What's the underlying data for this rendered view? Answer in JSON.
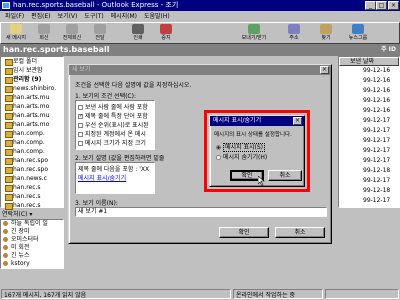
{
  "window": {
    "title": "han.rec.sports.baseball - Outlook Express - 조기"
  },
  "menu": [
    "파일(F)",
    "편집(E)",
    "보기(V)",
    "도구(T)",
    "메시지(M)",
    "도움말(H)"
  ],
  "toolbar": [
    "새 메시지",
    "회신",
    "전체회신",
    "전달",
    "인쇄",
    "중지",
    "보내기/받기",
    "주소",
    "찾기",
    "뉴스그룹"
  ],
  "folder_bar": {
    "name": "han.rec.sports.baseball",
    "right": "주 ID"
  },
  "tree": [
    "로컬 폴더",
    "임시 보관함",
    "관리함 (9)",
    "news.shinbiro.",
    "han.arts.mu",
    "han.arts.mo",
    "han.arts.mu",
    "han.arts.mo",
    "han.comp.",
    "han.comp.",
    "han.comp.",
    "han.rec.spo",
    "han.rec.spo",
    "han.news.c",
    "han.rec.s",
    "han.rec.s",
    "han.rec.s",
    "han.test ("
  ],
  "list": {
    "header": "보낸 날짜",
    "rows": [
      "99-12-16",
      "99-12-16",
      "99-12-16",
      "99-12-16",
      "99-12-16",
      "99-12-17",
      "99-12-17",
      "99-12-17",
      "99-12-17",
      "99-12-17",
      "99-12-18",
      "99-12-17",
      "99-12-18",
      "99-12-17",
      "99-12-17",
      "99-12-18",
      "99-12-18"
    ]
  },
  "contacts": {
    "header": "연락처(C) ▾",
    "items": [
      "하늘 독립이 일",
      "긴 장미",
      "오미스터터",
      "미 회전",
      "긴 뉴스",
      "kstory"
    ]
  },
  "status": {
    "left": "167개 메시지, 167개 읽지 않음",
    "right": "온라인에서 작업하는 중"
  },
  "view_dialog": {
    "title": "새 보기",
    "section1": "조건을 선택한 다음 설명에 값을 지정하십시오.",
    "label1": "1. 보기의 조건 선택(C):",
    "conditions": [
      "보낸 사람 줄에 사람 포함",
      "제목 줄에 특정 단어 포함",
      "우선 순위(표시)로 표시된",
      "지정된 계정에서 온 메시",
      "메시지 크기가 지정 크기"
    ],
    "label2": "2. 보기 설명 (값을 편집하려면 밑줄",
    "desc_line1": "제목 줄에 다음을 포함 : 'XX",
    "desc_line2": "메시지 표시/숨기기",
    "label3": "3. 보기 이름(N):",
    "name_value": "새 보기 #1",
    "ok": "확인",
    "cancel": "취소"
  },
  "show_dialog": {
    "title": "메시지 표시/숨기기",
    "prompt": "메시지의 표시 상태를 설정합니다.",
    "option1": "메시지 표시(S)",
    "option2": "메시지 숨기기(H)",
    "ok": "확인",
    "cancel": "취소",
    "close": "×"
  },
  "colors": {
    "title_bar": "#000080",
    "face": "#c0c0c0",
    "highlight_frame": "#ff0000"
  }
}
